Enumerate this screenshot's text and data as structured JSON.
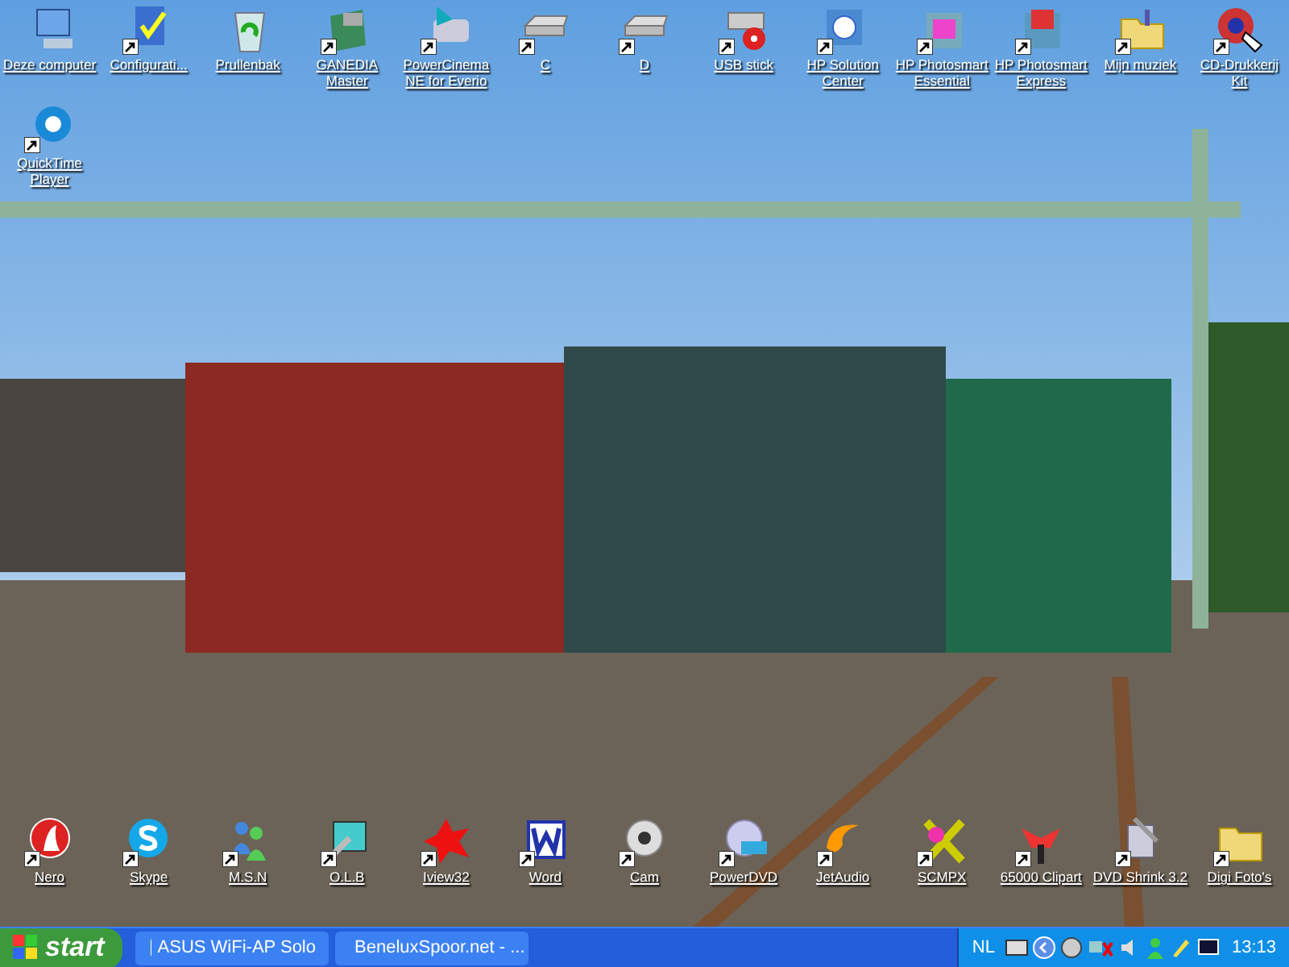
{
  "desktop": {
    "top_icons": [
      {
        "label": "Deze computer",
        "shortcut": false
      },
      {
        "label": "Configurati...",
        "shortcut": true
      },
      {
        "label": "Prullenbak",
        "shortcut": false
      },
      {
        "label": "GANEDIA Master",
        "shortcut": true
      },
      {
        "label": "PowerCinema NE for Everio",
        "shortcut": true
      },
      {
        "label": "C",
        "shortcut": true
      },
      {
        "label": "D",
        "shortcut": true
      },
      {
        "label": "USB stick",
        "shortcut": true
      },
      {
        "label": "HP Solution Center",
        "shortcut": true
      },
      {
        "label": "HP Photosmart Essential",
        "shortcut": true
      },
      {
        "label": "HP Photosmart Express",
        "shortcut": true
      },
      {
        "label": "Mijn muziek",
        "shortcut": true
      },
      {
        "label": "CD-Drukkerij Kit",
        "shortcut": true
      }
    ],
    "side_icons": [
      {
        "label": "QuickTime Player",
        "shortcut": true
      }
    ],
    "bottom_icons": [
      {
        "label": "Nero",
        "shortcut": true
      },
      {
        "label": "Skype",
        "shortcut": true
      },
      {
        "label": "M.S.N",
        "shortcut": true
      },
      {
        "label": "O.L.B",
        "shortcut": true
      },
      {
        "label": "Iview32",
        "shortcut": true
      },
      {
        "label": "Word",
        "shortcut": true
      },
      {
        "label": "Cam",
        "shortcut": true
      },
      {
        "label": "PowerDVD",
        "shortcut": true
      },
      {
        "label": "JetAudio",
        "shortcut": true
      },
      {
        "label": "SCMPX",
        "shortcut": true
      },
      {
        "label": "65000 Clipart",
        "shortcut": true
      },
      {
        "label": "DVD Shrink 3.2",
        "shortcut": true
      },
      {
        "label": "Digi Foto's",
        "shortcut": true
      }
    ]
  },
  "taskbar": {
    "start": "start",
    "tasks": [
      {
        "label": "ASUS WiFi-AP Solo"
      },
      {
        "label": "BeneluxSpoor.net - ..."
      }
    ],
    "language": "NL",
    "clock": "13:13"
  }
}
